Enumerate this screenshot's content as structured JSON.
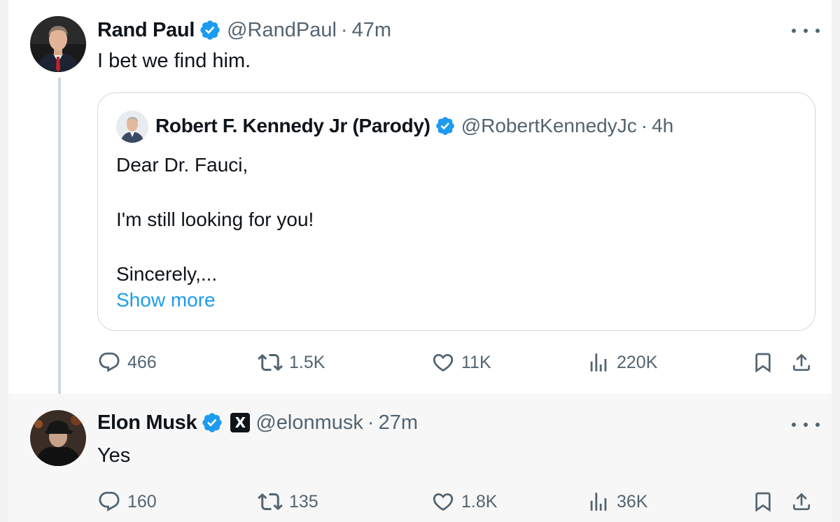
{
  "tweet_main": {
    "author_name": "Rand Paul",
    "handle": "@RandPaul",
    "separator": "·",
    "time": "47m",
    "text": "I bet we find him.",
    "verified_icon": "verified-badge-icon",
    "more_icon": "more-options-icon",
    "quote": {
      "author_name": "Robert F. Kennedy Jr (Parody)",
      "handle": "@RobertKennedyJc",
      "separator": "·",
      "time": "4h",
      "lines": [
        "Dear Dr. Fauci,",
        "I'm still looking for you!",
        "Sincerely,..."
      ],
      "show_more": "Show more"
    },
    "stats": {
      "replies": "466",
      "reposts": "1.5K",
      "likes": "11K",
      "views": "220K"
    }
  },
  "tweet_reply": {
    "author_name": "Elon Musk",
    "handle": "@elonmusk",
    "separator": "·",
    "time": "27m",
    "text": "Yes",
    "affiliation_badge": "X",
    "stats": {
      "replies": "160",
      "reposts": "135",
      "likes": "1.8K",
      "views": "36K"
    }
  },
  "colors": {
    "verified": "#1d9bf0",
    "link": "#1d9bf0",
    "secondary_text": "#536471",
    "primary_text": "#0f1419",
    "border": "#cfd9de"
  }
}
